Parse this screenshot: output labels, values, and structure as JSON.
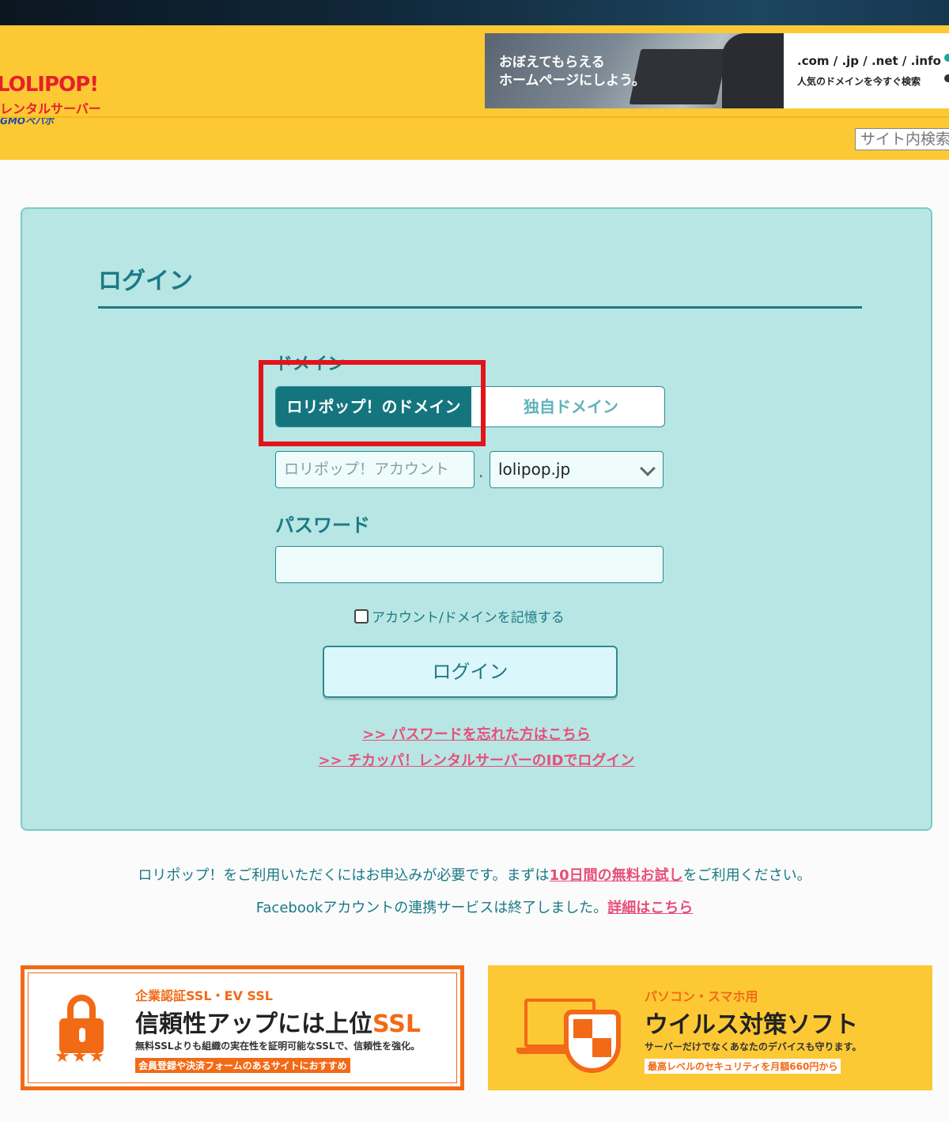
{
  "header": {
    "logo": {
      "main": "LOLIPOP!",
      "sub": "レンタルサーバー",
      "gmo": "GMOペパボ"
    },
    "banner": {
      "line1": "おぼえてもらえる",
      "line2": "ホームページにしよう。",
      "domains": ".com / .jp / .net / .info",
      "search": "人気のドメインを今すぐ検索"
    },
    "site_search_placeholder": "サイト内検索"
  },
  "login": {
    "title": "ログイン",
    "domain_label": "ドメイン",
    "toggle_active": "ロリポップ！のドメイン",
    "toggle_inactive": "独自ドメイン",
    "account_placeholder": "ロリポップ！アカウント",
    "separator": ".",
    "domain_selected": "lolipop.jp",
    "password_label": "パスワード",
    "remember_label": "アカウント/ドメインを記憶する",
    "login_button": "ログイン",
    "forgot_link": ">> パスワードを忘れた方はこちら",
    "chicappa_link": ">> チカッパ！レンタルサーバーのIDでログイン"
  },
  "notices": {
    "line1_before": "ロリポップ！をご利用いただくにはお申込みが必要です。まずは",
    "line1_link": "10日間の無料お試し",
    "line1_after": "をご利用ください。",
    "line2_before": "Facebookアカウントの連携サービスは終了しました。",
    "line2_link": "詳細はこちら"
  },
  "ads": {
    "ssl": {
      "tag": "企業認証SSL・EV SSL",
      "title_before": "信頼性アップには上位",
      "title_accent": "SSL",
      "desc": "無料SSLよりも組織の実在性を証明可能なSSLで、信頼性を強化。",
      "badge": "会員登録や決済フォームのあるサイトにおすすめ",
      "stars": "★★★"
    },
    "virus": {
      "tag": "パソコン・スマホ用",
      "title": "ウイルス対策ソフト",
      "desc": "サーバーだけでなくあなたのデバイスも守ります。",
      "badge": "最高レベルのセキュリティを月額660円から"
    }
  },
  "colors": {
    "header_yellow": "#fcc935",
    "panel_teal": "#b8e6e4",
    "accent_teal": "#1a7a85",
    "link_pink": "#e74f7a",
    "highlight_red": "#e3131b",
    "ad_orange": "#f26a16"
  }
}
